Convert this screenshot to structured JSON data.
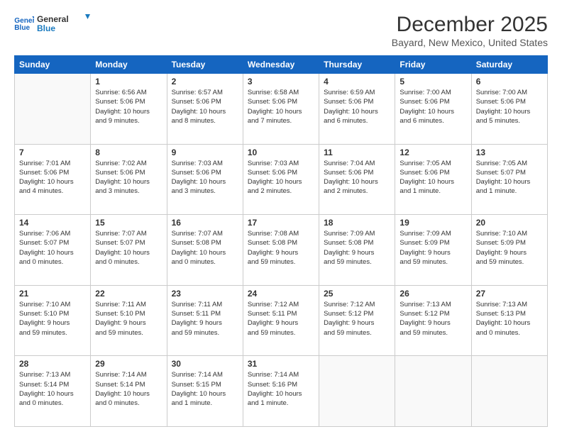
{
  "header": {
    "logo": {
      "line1": "General",
      "line2": "Blue"
    },
    "title": "December 2025",
    "subtitle": "Bayard, New Mexico, United States"
  },
  "calendar": {
    "days_of_week": [
      "Sunday",
      "Monday",
      "Tuesday",
      "Wednesday",
      "Thursday",
      "Friday",
      "Saturday"
    ],
    "weeks": [
      [
        {
          "day": "",
          "info": ""
        },
        {
          "day": "1",
          "info": "Sunrise: 6:56 AM\nSunset: 5:06 PM\nDaylight: 10 hours\nand 9 minutes."
        },
        {
          "day": "2",
          "info": "Sunrise: 6:57 AM\nSunset: 5:06 PM\nDaylight: 10 hours\nand 8 minutes."
        },
        {
          "day": "3",
          "info": "Sunrise: 6:58 AM\nSunset: 5:06 PM\nDaylight: 10 hours\nand 7 minutes."
        },
        {
          "day": "4",
          "info": "Sunrise: 6:59 AM\nSunset: 5:06 PM\nDaylight: 10 hours\nand 6 minutes."
        },
        {
          "day": "5",
          "info": "Sunrise: 7:00 AM\nSunset: 5:06 PM\nDaylight: 10 hours\nand 6 minutes."
        },
        {
          "day": "6",
          "info": "Sunrise: 7:00 AM\nSunset: 5:06 PM\nDaylight: 10 hours\nand 5 minutes."
        }
      ],
      [
        {
          "day": "7",
          "info": "Sunrise: 7:01 AM\nSunset: 5:06 PM\nDaylight: 10 hours\nand 4 minutes."
        },
        {
          "day": "8",
          "info": "Sunrise: 7:02 AM\nSunset: 5:06 PM\nDaylight: 10 hours\nand 3 minutes."
        },
        {
          "day": "9",
          "info": "Sunrise: 7:03 AM\nSunset: 5:06 PM\nDaylight: 10 hours\nand 3 minutes."
        },
        {
          "day": "10",
          "info": "Sunrise: 7:03 AM\nSunset: 5:06 PM\nDaylight: 10 hours\nand 2 minutes."
        },
        {
          "day": "11",
          "info": "Sunrise: 7:04 AM\nSunset: 5:06 PM\nDaylight: 10 hours\nand 2 minutes."
        },
        {
          "day": "12",
          "info": "Sunrise: 7:05 AM\nSunset: 5:06 PM\nDaylight: 10 hours\nand 1 minute."
        },
        {
          "day": "13",
          "info": "Sunrise: 7:05 AM\nSunset: 5:07 PM\nDaylight: 10 hours\nand 1 minute."
        }
      ],
      [
        {
          "day": "14",
          "info": "Sunrise: 7:06 AM\nSunset: 5:07 PM\nDaylight: 10 hours\nand 0 minutes."
        },
        {
          "day": "15",
          "info": "Sunrise: 7:07 AM\nSunset: 5:07 PM\nDaylight: 10 hours\nand 0 minutes."
        },
        {
          "day": "16",
          "info": "Sunrise: 7:07 AM\nSunset: 5:08 PM\nDaylight: 10 hours\nand 0 minutes."
        },
        {
          "day": "17",
          "info": "Sunrise: 7:08 AM\nSunset: 5:08 PM\nDaylight: 9 hours\nand 59 minutes."
        },
        {
          "day": "18",
          "info": "Sunrise: 7:09 AM\nSunset: 5:08 PM\nDaylight: 9 hours\nand 59 minutes."
        },
        {
          "day": "19",
          "info": "Sunrise: 7:09 AM\nSunset: 5:09 PM\nDaylight: 9 hours\nand 59 minutes."
        },
        {
          "day": "20",
          "info": "Sunrise: 7:10 AM\nSunset: 5:09 PM\nDaylight: 9 hours\nand 59 minutes."
        }
      ],
      [
        {
          "day": "21",
          "info": "Sunrise: 7:10 AM\nSunset: 5:10 PM\nDaylight: 9 hours\nand 59 minutes."
        },
        {
          "day": "22",
          "info": "Sunrise: 7:11 AM\nSunset: 5:10 PM\nDaylight: 9 hours\nand 59 minutes."
        },
        {
          "day": "23",
          "info": "Sunrise: 7:11 AM\nSunset: 5:11 PM\nDaylight: 9 hours\nand 59 minutes."
        },
        {
          "day": "24",
          "info": "Sunrise: 7:12 AM\nSunset: 5:11 PM\nDaylight: 9 hours\nand 59 minutes."
        },
        {
          "day": "25",
          "info": "Sunrise: 7:12 AM\nSunset: 5:12 PM\nDaylight: 9 hours\nand 59 minutes."
        },
        {
          "day": "26",
          "info": "Sunrise: 7:13 AM\nSunset: 5:12 PM\nDaylight: 9 hours\nand 59 minutes."
        },
        {
          "day": "27",
          "info": "Sunrise: 7:13 AM\nSunset: 5:13 PM\nDaylight: 10 hours\nand 0 minutes."
        }
      ],
      [
        {
          "day": "28",
          "info": "Sunrise: 7:13 AM\nSunset: 5:14 PM\nDaylight: 10 hours\nand 0 minutes."
        },
        {
          "day": "29",
          "info": "Sunrise: 7:14 AM\nSunset: 5:14 PM\nDaylight: 10 hours\nand 0 minutes."
        },
        {
          "day": "30",
          "info": "Sunrise: 7:14 AM\nSunset: 5:15 PM\nDaylight: 10 hours\nand 1 minute."
        },
        {
          "day": "31",
          "info": "Sunrise: 7:14 AM\nSunset: 5:16 PM\nDaylight: 10 hours\nand 1 minute."
        },
        {
          "day": "",
          "info": ""
        },
        {
          "day": "",
          "info": ""
        },
        {
          "day": "",
          "info": ""
        }
      ]
    ]
  }
}
